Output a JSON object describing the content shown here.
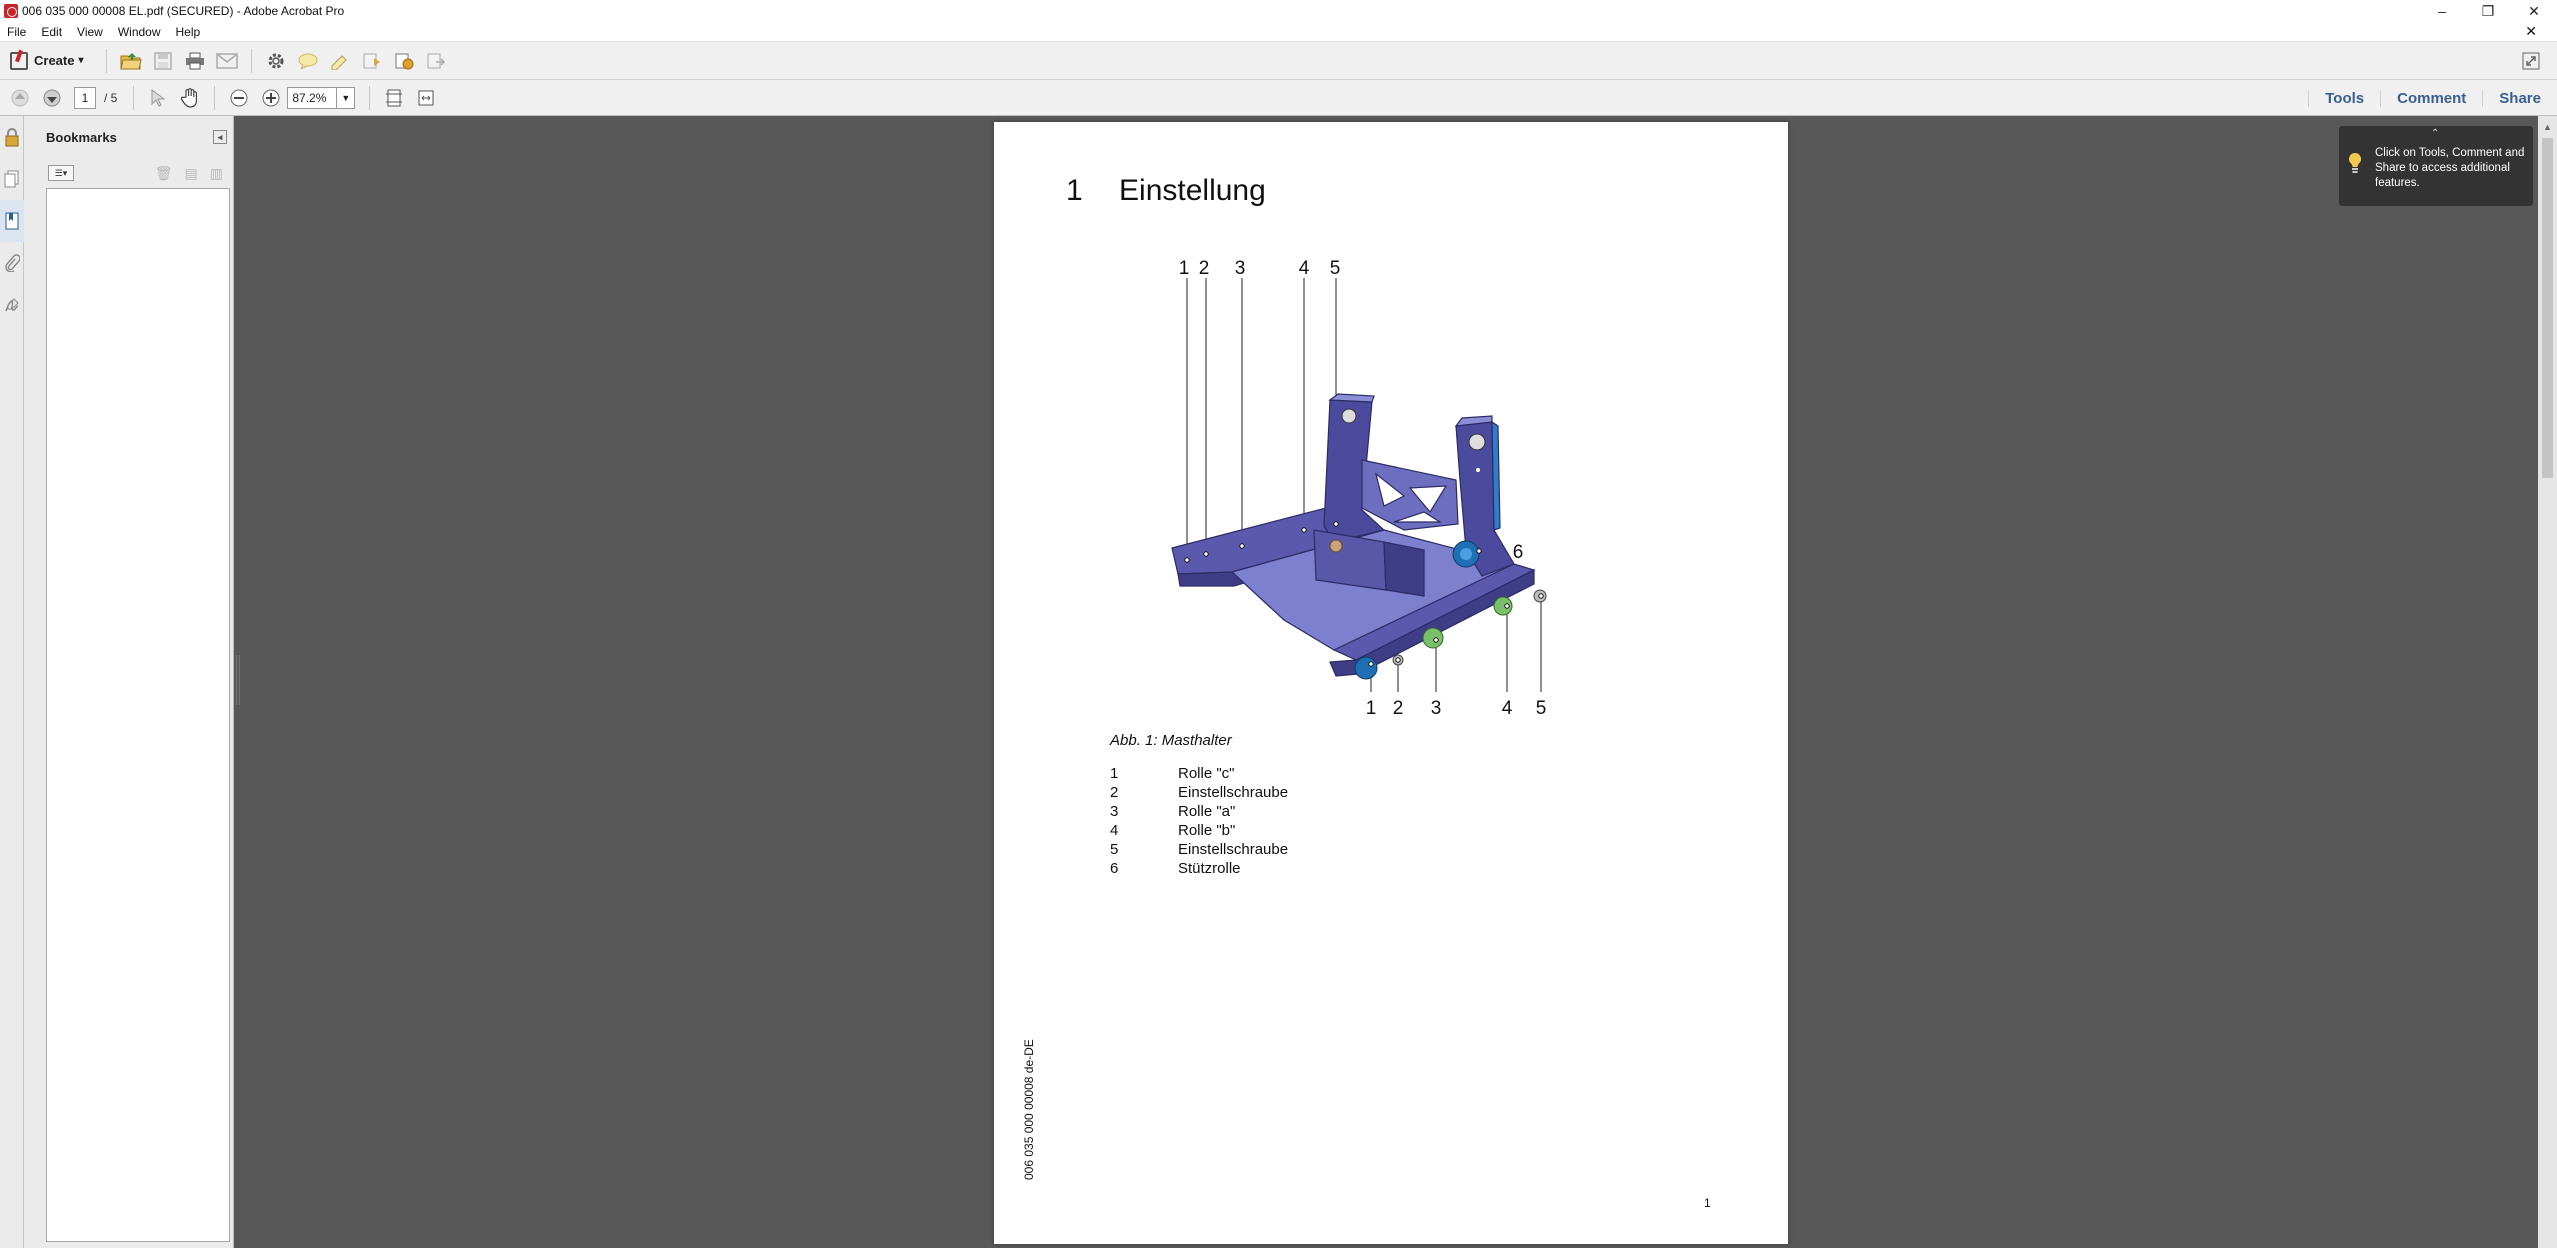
{
  "window": {
    "title": "006 035 000 00008 EL.pdf (SECURED) - Adobe Acrobat Pro",
    "controls": {
      "minimize": "–",
      "restore": "❐",
      "close": "✕"
    }
  },
  "menu": {
    "items": [
      "File",
      "Edit",
      "View",
      "Window",
      "Help"
    ],
    "close_doc": "✕"
  },
  "toolbar": {
    "create_label": "Create",
    "create_arrow": "▾",
    "icons": [
      "open-icon",
      "save-icon",
      "print-icon",
      "email-icon",
      "settings-icon",
      "comment-icon",
      "highlight-icon",
      "attach-icon",
      "stamp-icon",
      "share-icon"
    ],
    "expand_icon": "fullscreen-icon"
  },
  "navigation": {
    "current_page": "1",
    "total_pages": "/ 5",
    "zoom": "87.2%",
    "right_links": [
      "Tools",
      "Comment",
      "Share"
    ]
  },
  "bookmarks": {
    "header": "Bookmarks",
    "collapse": "◂",
    "options": "☰▾"
  },
  "document": {
    "heading_number": "1",
    "heading_text": "Einstellung",
    "callouts_top": [
      "1",
      "2",
      "3",
      "4",
      "5"
    ],
    "callouts_bottom": [
      "1",
      "2",
      "3",
      "4",
      "5"
    ],
    "callout_side": "6",
    "caption": "Abb. 1: Masthalter",
    "legend": [
      {
        "n": "1",
        "text": "Rolle \"c\""
      },
      {
        "n": "2",
        "text": "Einstellschraube"
      },
      {
        "n": "3",
        "text": "Rolle \"a\""
      },
      {
        "n": "4",
        "text": "Rolle \"b\""
      },
      {
        "n": "5",
        "text": "Einstellschraube"
      },
      {
        "n": "6",
        "text": "Stützrolle"
      }
    ],
    "doc_code": "006 035 000 00008 de-DE",
    "page_number": "1"
  },
  "tooltip": {
    "text": "Click on Tools, Comment and Share to access additional features.",
    "arrow": "⌃"
  },
  "colors": {
    "workspace": "#585858",
    "frame_body": "#4b4a9c",
    "frame_light": "#8d8fd6",
    "link": "#3a5f8f"
  }
}
